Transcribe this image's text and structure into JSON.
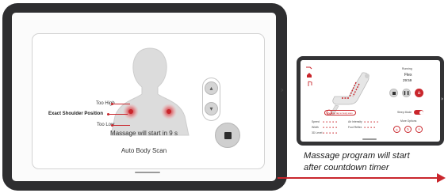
{
  "main_screen": {
    "labels": {
      "too_high": "Too High",
      "exact": "Exact Shoulder Position",
      "too_low": "Too Low"
    },
    "countdown_message": "Massage will start in 9 s",
    "mode_label": "Auto Body Scan",
    "icons": {
      "up": "▴",
      "down": "▾",
      "next": "›"
    }
  },
  "running_screen": {
    "status": "Running",
    "program": "Flex",
    "timer": "29:59",
    "shoulder_tap_text": "Shoulder tap to body scan",
    "sleep_mode_label": "Sleep Mode",
    "sleep_mode_on": true,
    "more_options_label": "More Options",
    "settings": [
      {
        "label": "Speed",
        "dots": "● ● ● ● ●"
      },
      {
        "label": "Air Intensity",
        "dots": "● ● ● ● ●"
      },
      {
        "label": "Width",
        "dots": "● ● ● ● ●"
      },
      {
        "label": "Foot Reflex",
        "dots": "● ● ● ●"
      },
      {
        "label": "3D Level",
        "dots": "● ● ● ● ●"
      }
    ]
  },
  "caption": {
    "line1": "Massage program will start",
    "line2": "after countdown timer"
  },
  "colors": {
    "accent": "#c9262c",
    "bezel": "#2e2e30"
  }
}
